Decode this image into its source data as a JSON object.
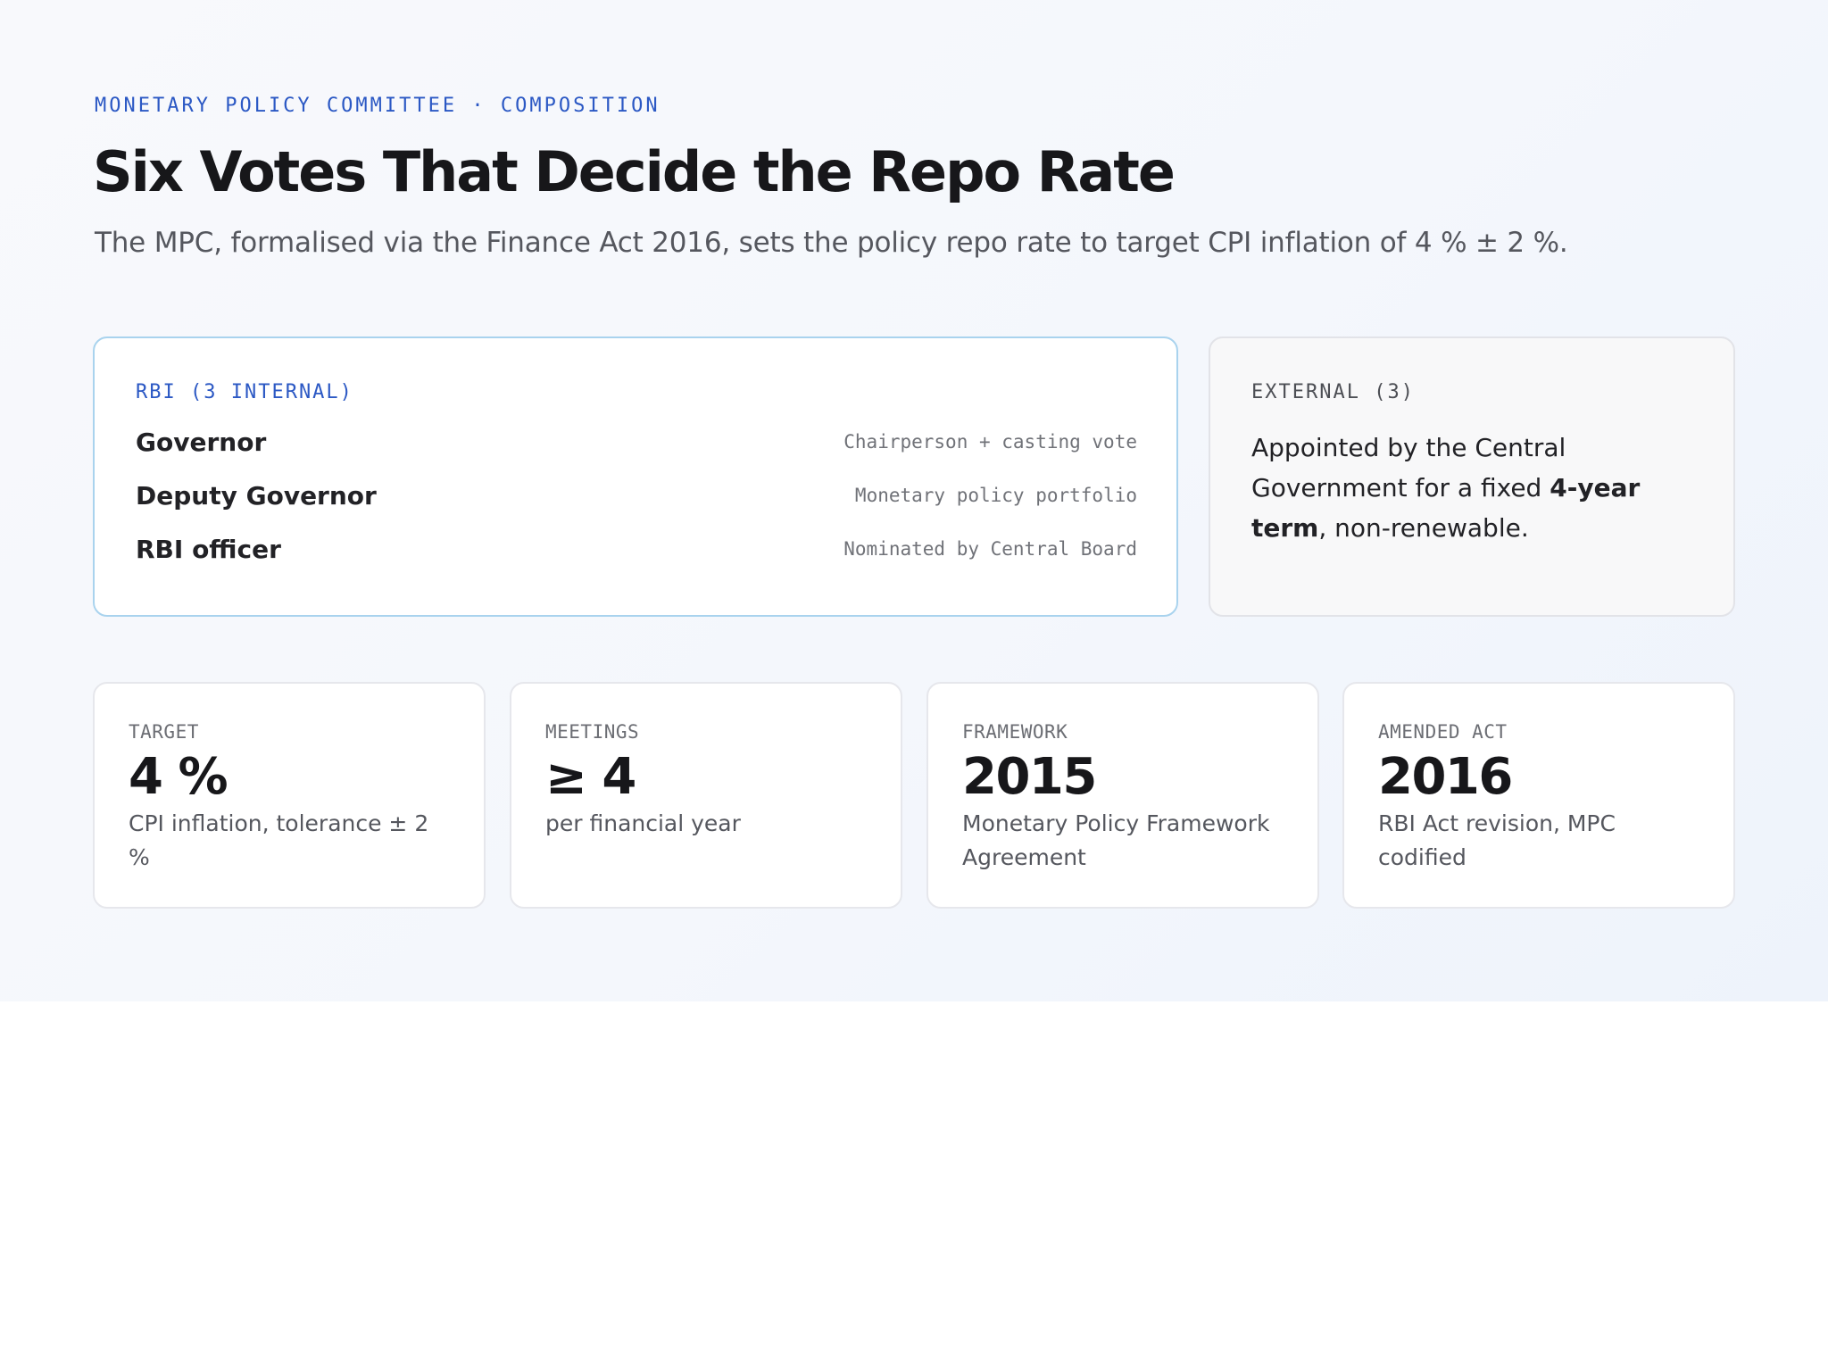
{
  "header": {
    "eyebrow": "MONETARY POLICY COMMITTEE · COMPOSITION",
    "title": "Six Votes That Decide the Repo Rate",
    "subtitle": "The MPC, formalised via the Finance Act 2016, sets the policy repo rate to target CPI inflation of 4 % ± 2 %."
  },
  "rbi_card": {
    "label": "RBI (3 INTERNAL)",
    "members": [
      {
        "name": "Governor",
        "role": "Chairperson + casting vote"
      },
      {
        "name": "Deputy Governor",
        "role": "Monetary policy portfolio"
      },
      {
        "name": "RBI officer",
        "role": "Nominated by Central Board"
      }
    ]
  },
  "external_card": {
    "label": "EXTERNAL (3)",
    "text_before": "Appointed by the Central Government for a fixed ",
    "text_bold": "4-year term",
    "text_after": ", non-renewable."
  },
  "stats": [
    {
      "label": "TARGET",
      "value": "4 %",
      "desc": "CPI inflation, tolerance ± 2 %"
    },
    {
      "label": "MEETINGS",
      "value": "≥ 4",
      "desc": "per financial year"
    },
    {
      "label": "FRAMEWORK",
      "value": "2015",
      "desc": "Monetary Policy Framework Agreement"
    },
    {
      "label": "AMENDED ACT",
      "value": "2016",
      "desc": "RBI Act revision, MPC codified"
    }
  ]
}
